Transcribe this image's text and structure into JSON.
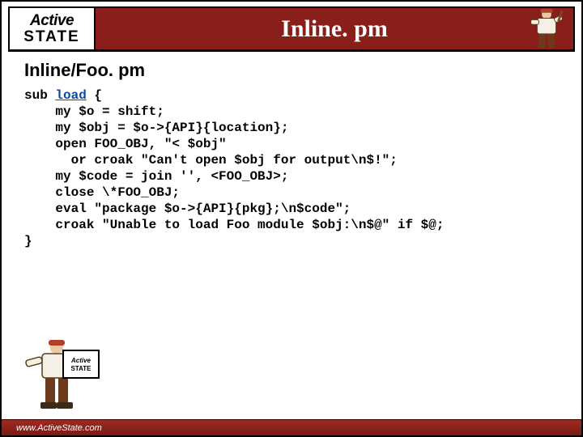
{
  "logo": {
    "line1": "Active",
    "line2": "STATE"
  },
  "title": "Inline. pm",
  "subtitle": "Inline/Foo. pm",
  "code": {
    "sub": "sub ",
    "load": "load",
    "open_brace": " {",
    "l1": "    my $o = shift;",
    "l2": "    my $obj = $o->{API}{location};",
    "l3": "    open FOO_OBJ, \"< $obj\"",
    "l4": "      or croak \"Can't open $obj for output\\n$!\";",
    "l5": "    my $code = join '', <FOO_OBJ>;",
    "l6": "    close \\*FOO_OBJ;",
    "l7": "    eval \"package $o->{API}{pkg};\\n$code\";",
    "l8": "    croak \"Unable to load Foo module $obj:\\n$@\" if $@;",
    "close": "}"
  },
  "footer": {
    "url": "www.ActiveState.com"
  }
}
